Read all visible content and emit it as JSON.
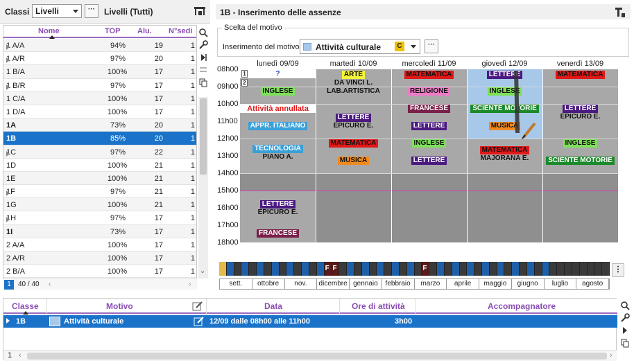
{
  "left": {
    "classi_label": "Classi",
    "classi_select": "Livelli",
    "dots": "···",
    "livelli_label": "Livelli (Tutti)",
    "columns": [
      "Nome",
      "TOP",
      "Alu.",
      "N°sedi"
    ],
    "rows": [
      {
        "nome": "1 A/A",
        "top": "94%",
        "alu": "19",
        "sedi": "1",
        "tree": true,
        "bold": false,
        "selected": false
      },
      {
        "nome": "1 A/R",
        "top": "97%",
        "alu": "20",
        "sedi": "1",
        "tree": true,
        "bold": false,
        "selected": false
      },
      {
        "nome": "1 B/A",
        "top": "100%",
        "alu": "17",
        "sedi": "1",
        "tree": false,
        "bold": false,
        "selected": false
      },
      {
        "nome": "1 B/R",
        "top": "97%",
        "alu": "17",
        "sedi": "1",
        "tree": true,
        "bold": false,
        "selected": false
      },
      {
        "nome": "1 C/A",
        "top": "100%",
        "alu": "17",
        "sedi": "1",
        "tree": false,
        "bold": false,
        "selected": false
      },
      {
        "nome": "1 D/A",
        "top": "100%",
        "alu": "17",
        "sedi": "1",
        "tree": false,
        "bold": false,
        "selected": false
      },
      {
        "nome": "1A",
        "top": "73%",
        "alu": "20",
        "sedi": "1",
        "tree": false,
        "bold": true,
        "selected": false
      },
      {
        "nome": "1B",
        "top": "85%",
        "alu": "20",
        "sedi": "1",
        "tree": false,
        "bold": true,
        "selected": true
      },
      {
        "nome": "1C",
        "top": "97%",
        "alu": "22",
        "sedi": "1",
        "tree": true,
        "bold": false,
        "selected": false
      },
      {
        "nome": "1D",
        "top": "100%",
        "alu": "21",
        "sedi": "1",
        "tree": false,
        "bold": false,
        "selected": false
      },
      {
        "nome": "1E",
        "top": "100%",
        "alu": "21",
        "sedi": "1",
        "tree": false,
        "bold": false,
        "selected": false
      },
      {
        "nome": "1F",
        "top": "97%",
        "alu": "21",
        "sedi": "1",
        "tree": true,
        "bold": false,
        "selected": false
      },
      {
        "nome": "1G",
        "top": "100%",
        "alu": "21",
        "sedi": "1",
        "tree": false,
        "bold": false,
        "selected": false
      },
      {
        "nome": "1H",
        "top": "97%",
        "alu": "17",
        "sedi": "1",
        "tree": true,
        "bold": false,
        "selected": false
      },
      {
        "nome": "1I",
        "top": "73%",
        "alu": "17",
        "sedi": "1",
        "tree": false,
        "bold": true,
        "selected": false
      },
      {
        "nome": "2 A/A",
        "top": "100%",
        "alu": "17",
        "sedi": "1",
        "tree": false,
        "bold": false,
        "selected": false
      },
      {
        "nome": "2 A/R",
        "top": "100%",
        "alu": "17",
        "sedi": "1",
        "tree": false,
        "bold": false,
        "selected": false
      },
      {
        "nome": "2 B/A",
        "top": "100%",
        "alu": "17",
        "sedi": "1",
        "tree": false,
        "bold": false,
        "selected": false
      }
    ],
    "page_current": "1",
    "page_total": "40 / 40"
  },
  "right": {
    "title": "1B - Inserimento delle assenze",
    "group_legend": "Scelta del motivo",
    "motivo_label": "Inserimento del motivo",
    "motivo_value": "Attività culturale",
    "motivo_badge": "C",
    "days": [
      "lunedì 09/09",
      "martedì 10/09",
      "mercoledì 11/09",
      "giovedì 12/09",
      "venerdì 13/09"
    ],
    "hours": [
      "08h00",
      "09h00",
      "10h00",
      "11h00",
      "12h00",
      "13h00",
      "14h00",
      "15h00",
      "16h00",
      "17h00",
      "18h00"
    ],
    "week_rows": [
      "1",
      "2"
    ],
    "question": "?",
    "annullata": "Attività annullata",
    "lessons": {
      "mon": [
        {
          "label": "INGLESE",
          "bg": "#7ee05a",
          "fg": "#111"
        },
        {
          "label": "APPR. ITALIANO",
          "bg": "#3aa0d8",
          "fg": "#fff"
        },
        {
          "label": "TECNOLOGIA",
          "bg": "#3aa0d8",
          "fg": "#fff",
          "teacher": "PIANO A."
        },
        {
          "label": "LETTERE",
          "bg": "#4b1a80",
          "fg": "#fff",
          "teacher": "EPICURO E."
        },
        {
          "label": "FRANCESE",
          "bg": "#7a1f4a",
          "fg": "#fff"
        }
      ],
      "tue": [
        {
          "label": "ARTE",
          "bg": "#f5f53a",
          "fg": "#111",
          "teacher": "DA VINCI L.",
          "teacher2": "LAB.ARTISTICA"
        },
        {
          "label": "LETTERE",
          "bg": "#4b1a80",
          "fg": "#fff",
          "teacher": "EPICURO E."
        },
        {
          "label": "MATEMATICA",
          "bg": "#e01818",
          "fg": "#111"
        },
        {
          "label": "MUSICA",
          "bg": "#f08a20",
          "fg": "#111"
        }
      ],
      "wed": [
        {
          "label": "MATEMATICA",
          "bg": "#e01818",
          "fg": "#111"
        },
        {
          "label": "RELIGIONE",
          "bg": "#f07ac8",
          "fg": "#111"
        },
        {
          "label": "FRANCESE",
          "bg": "#7a1f4a",
          "fg": "#fff"
        },
        {
          "label": "LETTERE",
          "bg": "#4b1a80",
          "fg": "#fff"
        },
        {
          "label": "INGLESE",
          "bg": "#7ee05a",
          "fg": "#111"
        },
        {
          "label": "LETTERE",
          "bg": "#4b1a80",
          "fg": "#fff"
        }
      ],
      "thu": [
        {
          "label": "LETTERE",
          "bg": "#4b1a80",
          "fg": "#fff"
        },
        {
          "label": "INGLESE",
          "bg": "#7ee05a",
          "fg": "#111"
        },
        {
          "label": "SCIENTE MOTORIE",
          "bg": "#1a8a2a",
          "fg": "#fff"
        },
        {
          "label": "MUSICA",
          "bg": "#f08a20",
          "fg": "#111"
        },
        {
          "label": "MATEMATICA",
          "bg": "#e01818",
          "fg": "#111",
          "teacher": "MAJORANA E."
        }
      ],
      "fri": [
        {
          "label": "MATEMATICA",
          "bg": "#e01818",
          "fg": "#111"
        },
        {
          "label": "LETTERE",
          "bg": "#4b1a80",
          "fg": "#fff",
          "teacher": "EPICURO E."
        },
        {
          "label": "INGLESE",
          "bg": "#7ee05a",
          "fg": "#111"
        },
        {
          "label": "SCIENTE MOTORIE",
          "bg": "#1a8a2a",
          "fg": "#fff"
        }
      ]
    },
    "months": [
      "sett.",
      "ottobre",
      "nov.",
      "dicembre",
      "gennaio",
      "febbraio",
      "marzo",
      "aprile",
      "maggio",
      "giugno",
      "luglio",
      "agosto"
    ],
    "holiday_mark": "F"
  },
  "bottom": {
    "columns": [
      "Classe",
      "Motivo",
      "Data",
      "Ore di attività",
      "Accompagnatore"
    ],
    "row": {
      "classe": "1B",
      "motivo": "Attività culturale",
      "data": "12/09 dalle 08h00 alle 11h00",
      "ore": "3h00",
      "accompagnatore": ""
    },
    "page_current": "1"
  },
  "colors": {
    "accent": "#1a73c9",
    "header_text": "#8a4db3",
    "grid": "#a8a8a8",
    "selection": "#a8c8ea"
  }
}
